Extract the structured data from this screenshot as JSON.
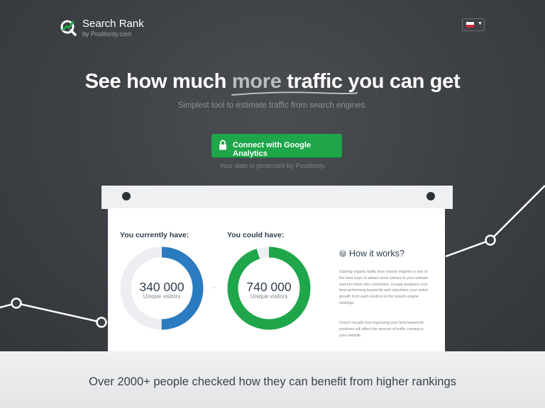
{
  "brand": {
    "name": "Search Rank",
    "byline": "by Positionly.com",
    "logo_icon": "magnifier-icon",
    "accent": "#1fa64a"
  },
  "language_selector": {
    "flag_icon": "poland-flag-icon",
    "caret_icon": "caret-down-icon",
    "caret": "▼"
  },
  "hero": {
    "headline_before": "See how much ",
    "headline_highlight": "more",
    "headline_after": " traffic you can get",
    "subtitle": "Simplest tool to estimate traffic from search engines.",
    "cta_label": "Connect with Google Analytics",
    "cta_icon": "lock-icon",
    "cta_color": "#1fa64a",
    "protection_note": "Your date is protected by Positionly."
  },
  "stats": {
    "current": {
      "label": "You currently have:",
      "value": "340 000",
      "unit": "Unique visitors",
      "fraction": 0.5,
      "color": "#2a7bbf"
    },
    "potential": {
      "label": "You could have:",
      "value": "740 000",
      "unit": "Unique visitors",
      "fraction": 0.95,
      "color": "#1fa64a"
    },
    "arrow": "→"
  },
  "how_it_works": {
    "icon": "question-icon",
    "icon_text": "?",
    "title": "How it works?",
    "paragraph1": "Gaining organic traffic from search engines is one of the best ways to attract more visitors to your website and turn them into customers. xxxapp analyzes your best performing keywords and calculates your visitor growth from each position in the search engine rankings.",
    "paragraph2": "Check visually how improving your best keywords positions will affect the amount of traffic coming to your website."
  },
  "footer": {
    "text": "Over 2000+ people checked how they can benefit from higher rankings"
  }
}
